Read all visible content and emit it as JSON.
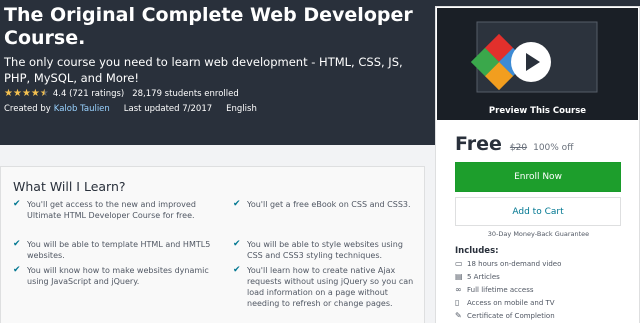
{
  "course": {
    "title": "The Original Complete Web Developer Course.",
    "subtitle": "The only course you need to learn web development - HTML, CSS, JS, PHP, MySQL, and More!",
    "rating": "4.4 (721 ratings)",
    "rating_value": 4.4,
    "students": "28,179 students enrolled",
    "created_by": "Created by",
    "author": "Kalob Taulien",
    "last_updated": "Last updated 7/2017",
    "language": "English"
  },
  "learn": {
    "heading": "What Will I Learn?",
    "items": [
      "You'll get access to the new and improved Ultimate HTML Developer Course for free.",
      "You'll get a free eBook on CSS and CSS3.",
      "You will be able to template HTML and HMTL5 websites.",
      "You will be able to style websites using CSS and CSS3 styling techniques.",
      "You will know how to make websites dynamic using JavaScript and jQuery.",
      "You'll learn how to create native Ajax requests without using jQuery so you can load information on a page without needing to refresh or change pages."
    ]
  },
  "sidebar": {
    "preview_label": "Preview This Course",
    "price": "Free",
    "old_price": "$20",
    "discount": "100% off",
    "enroll_label": "Enroll Now",
    "cart_label": "Add to Cart",
    "guarantee": "30-Day Money-Back Guarantee",
    "includes_heading": "Includes:",
    "includes": [
      {
        "icon": "video-icon",
        "text": "18 hours on-demand video"
      },
      {
        "icon": "article-icon",
        "text": "5 Articles"
      },
      {
        "icon": "infinity-icon",
        "text": "Full lifetime access"
      },
      {
        "icon": "mobile-icon",
        "text": "Access on mobile and TV"
      },
      {
        "icon": "certificate-icon",
        "text": "Certificate of Completion"
      }
    ]
  },
  "colors": {
    "hero_bg": "#29303b",
    "enroll_green": "#1d9e2c",
    "link_blue": "#007791",
    "star": "#f4c150"
  }
}
